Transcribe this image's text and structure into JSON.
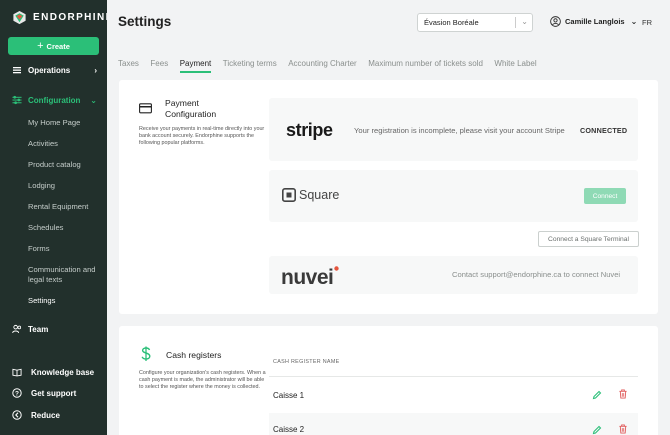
{
  "brand": {
    "name": "ENDORPHINE"
  },
  "sidebar": {
    "create_label": "Create",
    "operations_label": "Operations",
    "configuration_label": "Configuration",
    "sub_items": [
      {
        "label": "My Home Page"
      },
      {
        "label": "Activities"
      },
      {
        "label": "Product catalog"
      },
      {
        "label": "Lodging"
      },
      {
        "label": "Rental Equipment"
      },
      {
        "label": "Schedules"
      },
      {
        "label": "Forms"
      },
      {
        "label": "Communication and legal texts"
      },
      {
        "label": "Settings"
      }
    ],
    "team_label": "Team",
    "knowledge_label": "Knowledge base",
    "support_label": "Get support",
    "reduce_label": "Reduce"
  },
  "header": {
    "title": "Settings",
    "organization": "Évasion Boréale",
    "user_name": "Camille Langlois",
    "language": "FR"
  },
  "tabs": [
    {
      "label": "Taxes"
    },
    {
      "label": "Fees"
    },
    {
      "label": "Payment"
    },
    {
      "label": "Ticketing terms"
    },
    {
      "label": "Accounting Charter"
    },
    {
      "label": "Maximum number of tickets sold"
    },
    {
      "label": "White Label"
    }
  ],
  "active_tab": "Payment",
  "payment": {
    "title": "Payment Configuration",
    "description": "Receive your payments in real-time directly into your bank account securely. Endorphine supports the following popular platforms.",
    "stripe": {
      "logo": "stripe",
      "message": "Your registration is incomplete, please visit your account Stripe",
      "status": "CONNECTED"
    },
    "square": {
      "logo": "Square",
      "connect_label": "Connect",
      "terminal_label": "Connect a Square Terminal"
    },
    "nuvei": {
      "logo": "nuvei",
      "message": "Contact support@endorphine.ca to connect Nuvei"
    }
  },
  "cash": {
    "title": "Cash registers",
    "description": "Configure your organization's cash registers. When a cash payment is made, the administrator will be able to select the register where the money is collected.",
    "column_header": "CASH REGISTER NAME",
    "registers": [
      {
        "name": "Caisse 1"
      },
      {
        "name": "Caisse 2"
      }
    ]
  },
  "colors": {
    "accent": "#2bbf78",
    "sidebar_bg": "#22302c",
    "delete": "#e05b5b"
  }
}
